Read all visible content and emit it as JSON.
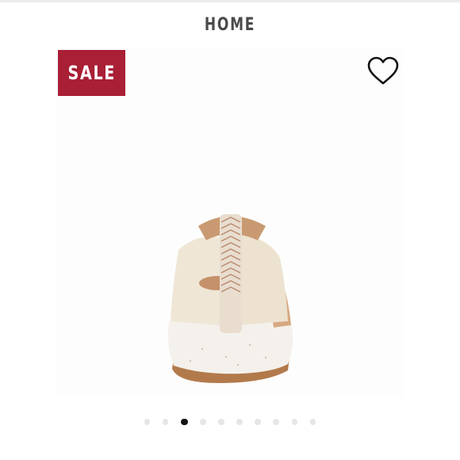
{
  "header": {
    "title": "HOME"
  },
  "badge": {
    "label": "SALE",
    "color": "#a91f35"
  },
  "wishlist": {
    "icon": "heart-outline-icon"
  },
  "product_image": {
    "subject": "sneaker"
  },
  "carousel": {
    "total": 10,
    "active_index": 2
  }
}
